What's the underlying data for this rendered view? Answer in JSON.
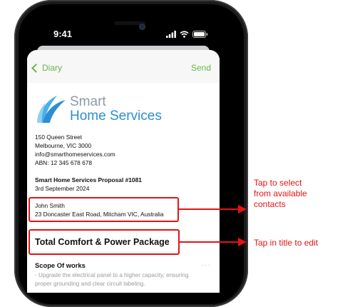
{
  "status_bar": {
    "time": "9:41"
  },
  "nav": {
    "back_label": "Diary",
    "send_label": "Send"
  },
  "company": {
    "logo_word1": "Smart",
    "logo_word2": "Home Services",
    "address_line1": "150 Queen Street",
    "address_line2": "Melbourne, VIC 3000",
    "email": "info@smarthomeservices.com",
    "abn": "ABN: 12 345 678 678"
  },
  "proposal": {
    "title": "Smart Home Services Proposal #1081",
    "date": "3rd September 2024"
  },
  "contact": {
    "name": "John Smith",
    "address": "23 Doncaster East Road, Mitcham VIC, Australia"
  },
  "package": {
    "title": "Total Comfort & Power Package"
  },
  "scope": {
    "title": "Scope Of works",
    "more": "···",
    "line1": "- Upgrade the electrical panel to a higher capacity, ensuring",
    "line2": "proper grounding and clear circuit labeling."
  },
  "annotations": {
    "contact_hint_line1": "Tap to select",
    "contact_hint_line2": "from available",
    "contact_hint_line3": "contacts",
    "title_hint": "Tap in title to edit"
  },
  "colors": {
    "accent_green": "#67b744",
    "logo_blue": "#2c8ed1",
    "annotation_red": "#e41414"
  },
  "icons": [
    "signal-icon",
    "wifi-icon",
    "battery-icon",
    "chevron-left-icon",
    "logo-swoosh-icon",
    "arrow-right-icon"
  ]
}
